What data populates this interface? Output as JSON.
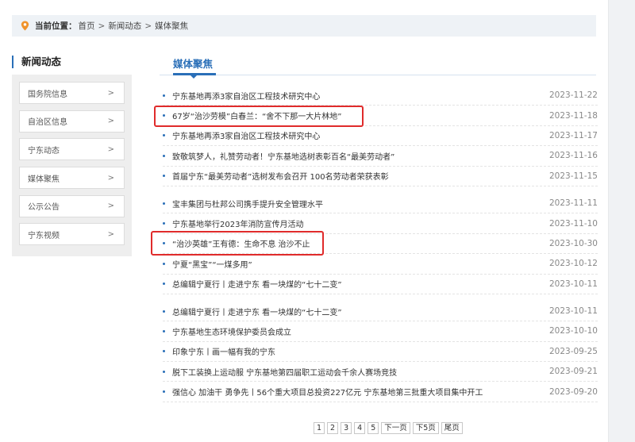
{
  "breadcrumb": {
    "label": "当前位置：",
    "items": [
      "首页",
      "新闻动态",
      "媒体聚焦"
    ],
    "separator": ">"
  },
  "sidebar": {
    "title": "新闻动态",
    "items": [
      {
        "label": "国务院信息",
        "arrow": ">"
      },
      {
        "label": "自治区信息",
        "arrow": ">"
      },
      {
        "label": "宁东动态",
        "arrow": ">"
      },
      {
        "label": "媒体聚焦",
        "arrow": ">"
      },
      {
        "label": "公示公告",
        "arrow": ">"
      },
      {
        "label": "宁东视频",
        "arrow": ">"
      }
    ]
  },
  "main": {
    "tab_title": "媒体聚焦",
    "groups": [
      [
        {
          "title": "宁东基地再添3家自治区工程技术研究中心",
          "date": "2023-11-22"
        },
        {
          "title": "67岁“治沙劳模”白春兰：“舍不下那一大片林地”",
          "date": "2023-11-18"
        },
        {
          "title": "宁东基地再添3家自治区工程技术研究中心",
          "date": "2023-11-17"
        },
        {
          "title": "致敬筑梦人，礼赞劳动者！宁东基地选树表彰百名“最美劳动者”",
          "date": "2023-11-16"
        },
        {
          "title": "首届宁东“最美劳动者”选树发布会召开 100名劳动者荣获表彰",
          "date": "2023-11-15"
        }
      ],
      [
        {
          "title": "宝丰集团与杜邦公司携手提升安全管理水平",
          "date": "2023-11-11"
        },
        {
          "title": "宁东基地举行2023年消防宣传月活动",
          "date": "2023-11-10"
        },
        {
          "title": "“治沙英雄”王有德：生命不息 治沙不止",
          "date": "2023-10-30"
        },
        {
          "title": "宁夏“黑宝”“一煤多用”",
          "date": "2023-10-12"
        },
        {
          "title": "总编辑宁夏行丨走进宁东 看一块煤的“七十二变”",
          "date": "2023-10-11"
        }
      ],
      [
        {
          "title": "总编辑宁夏行丨走进宁东 看一块煤的“七十二变”",
          "date": "2023-10-11"
        },
        {
          "title": "宁东基地生态环境保护委员会成立",
          "date": "2023-10-10"
        },
        {
          "title": "印象宁东丨画一幅有我的宁东",
          "date": "2023-09-25"
        },
        {
          "title": "脱下工装换上运动服 宁东基地第四届职工运动会千余人赛场竞技",
          "date": "2023-09-21"
        },
        {
          "title": "强信心 加油干 勇争先丨56个重大项目总投资227亿元 宁东基地第三批重大项目集中开工",
          "date": "2023-09-20"
        }
      ]
    ]
  },
  "pager": {
    "pages": [
      "1",
      "2",
      "3",
      "4",
      "5"
    ],
    "next": "下一页",
    "next5": "下5页",
    "last": "尾页"
  },
  "colors": {
    "accent": "#2a6fb8",
    "highlight": "#e02b2b",
    "pin": "#f0932b"
  }
}
